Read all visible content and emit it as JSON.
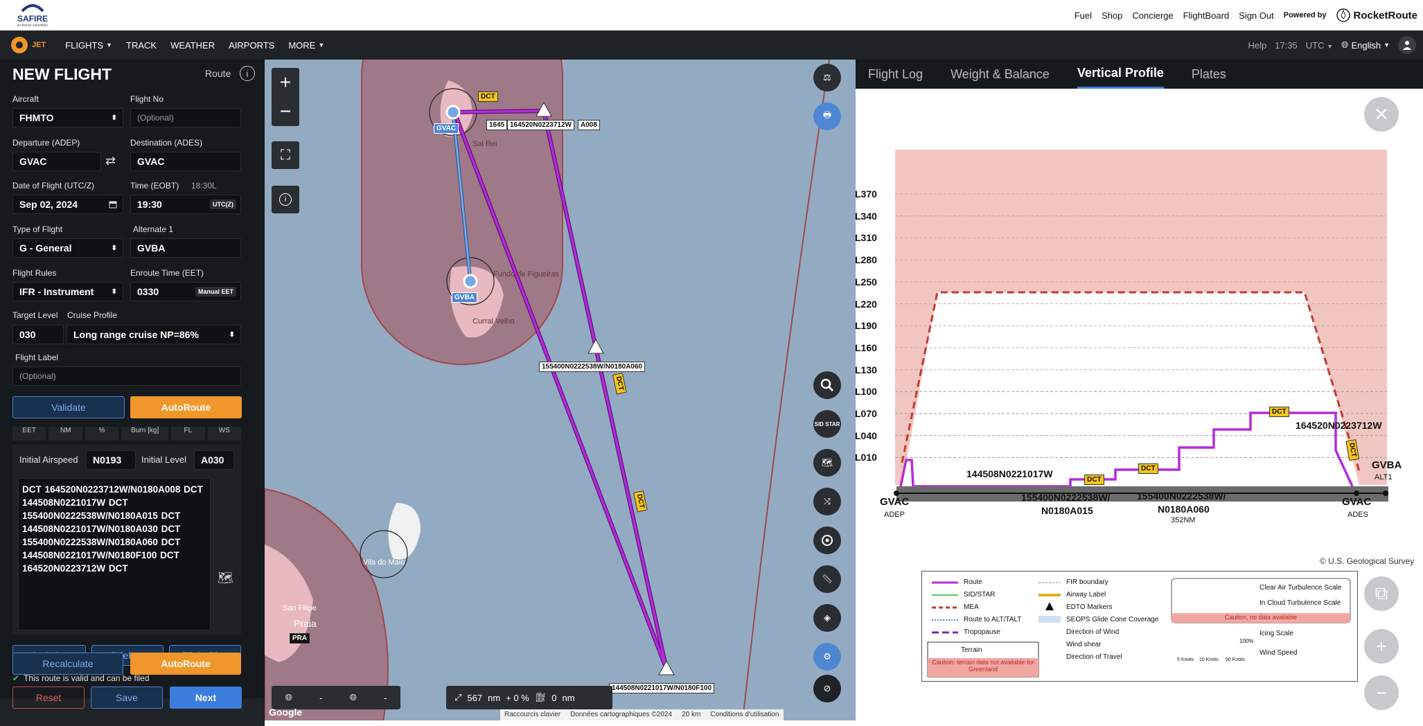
{
  "topbar": {
    "logo_text": "SAFIRE",
    "logo_sub": "an Avinor subsidiary",
    "links": [
      "Fuel",
      "Shop",
      "Concierge",
      "FlightBoard",
      "Sign Out"
    ],
    "powered": "Powered by",
    "brand": "RocketRoute"
  },
  "nav": {
    "jet": "JET",
    "items": [
      "FLIGHTS",
      "TRACK",
      "WEATHER",
      "AIRPORTS",
      "MORE"
    ],
    "help": "Help",
    "time": "17:35",
    "tz": "UTC",
    "language": "English"
  },
  "form": {
    "title": "NEW FLIGHT",
    "route_label": "Route",
    "aircraft_label": "Aircraft",
    "aircraft": "FHMTO",
    "flightno_label": "Flight No",
    "flightno_ph": "(Optional)",
    "dep_label": "Departure (ADEP)",
    "dep": "GVAC",
    "dest_label": "Destination (ADES)",
    "dest": "GVAC",
    "date_label": "Date of Flight (UTC/Z)",
    "date": "Sep 02, 2024",
    "time_label": "Time (EOBT)",
    "time_local": "18:30L",
    "time": "19:30",
    "utc": "UTC(Z)",
    "type_label": "Type of Flight",
    "type": "G - General",
    "alt_label": "Alternate 1",
    "alt": "GVBA",
    "rules_label": "Flight Rules",
    "rules": "IFR - Instrument",
    "eet_label": "Enroute Time (EET)",
    "eet": "0330",
    "manual": "Manual EET",
    "level_label": "Target Level",
    "cruise_label": "Cruise Profile",
    "level": "030",
    "cruise": "Long range cruise NP=86%",
    "label_label": "Flight Label",
    "label_ph": "(Optional)",
    "validate": "Validate",
    "autoroute": "AutoRoute",
    "cols": [
      "EET",
      "NM",
      "%",
      "Burn [kg]",
      "FL",
      "WS"
    ],
    "airspeed_label": "Initial Airspeed",
    "airspeed": "N0193",
    "initlevel_label": "Initial Level",
    "initlevel": "A030",
    "route_text": "DCT 164520N0223712W/N0180A008 DCT 144508N0221017W DCT 155400N0222538W/N0180A015 DCT 144508N0221017W/N0180A030 DCT 155400N0222538W/N0180A060 DCT 144508N0221017W/N0180F100 DCT 164520N0223712W DCT",
    "optimize": "Optimize",
    "briefing": "Briefing",
    "flightplan": "Flight Plan",
    "valid_msg": "This route is valid and can be filed",
    "recalc": "Recalculate",
    "autoroute2": "AutoRoute",
    "reset": "Reset",
    "save": "Save",
    "next": "Next"
  },
  "map": {
    "gvac": "GVAC",
    "gvba": "GVBA",
    "pra": "PRA",
    "dct": "DCT",
    "wp1": "164520N0223712W",
    "wp1b": "A008",
    "wp1a": "1645",
    "wp2": "155400N0222538W/N0180A060",
    "wp3": "144508N0221017W/N0180F100",
    "places": [
      "Sal Rei",
      "Fundo de Figueiras",
      "Curral Velho",
      "Praia",
      "Sao Filipe",
      "Vila do Maio"
    ],
    "sidstar": "SID STAR",
    "dist": "567",
    "dist_unit": "nm",
    "pct": "+ 0 %",
    "zero": "0",
    "zero_unit": "nm",
    "dash1": "-",
    "dash2": "-",
    "attr": [
      "Raccourcis clavier",
      "Données cartographiques ©2024",
      "20 km",
      "Conditions d'utilisation"
    ],
    "google": "Google"
  },
  "panel": {
    "tabs": [
      "Flight Log",
      "Weight & Balance",
      "Vertical Profile",
      "Plates"
    ],
    "active": 2,
    "levels": [
      "L370",
      "L340",
      "L310",
      "L280",
      "L250",
      "L220",
      "L190",
      "L160",
      "L130",
      "L100",
      "L070",
      "L040",
      "L010"
    ],
    "labels": {
      "gvac1": "GVAC",
      "adep": "ADEP",
      "gvac2": "GVAC",
      "ades": "ADES",
      "gvba": "GVBA",
      "alt1": "ALT1",
      "wpa": "144508N0221017W",
      "wpb": "155400N0222538W/",
      "wpb2": "N0180A015",
      "wpc": "155400N0222538W/",
      "wpc2": "N0180A060",
      "nm": "352NM",
      "wpd": "164520N0223712W",
      "dct": "DCT"
    },
    "copyright": "© U.S. Geological Survey",
    "legend": [
      "Route",
      "SID/STAR",
      "MEA",
      "Route to ALT/TALT",
      "Tropopause",
      "Terrain",
      "FIR boundary",
      "Airway Label",
      "EDTO Markers",
      "SEOPS Glide Cone Coverage",
      "Direction of Wind",
      "Wind shear",
      "Direction of Travel",
      "Clear Air Turbulence Scale",
      "In Cloud Turbulence Scale",
      "Icing Scale",
      "Wind Speed"
    ],
    "caution1": "Caution: terrain data not available for Greenland",
    "caution2": "Caution, no data available",
    "icing_pct": "100%",
    "speeds": [
      "5 Knots",
      "10 Knots",
      "50 Knots"
    ]
  },
  "colors": {
    "route": "#b42bd8",
    "fir": "#a0484f",
    "accent": "#3b7ddc",
    "orange": "#f0962a"
  }
}
